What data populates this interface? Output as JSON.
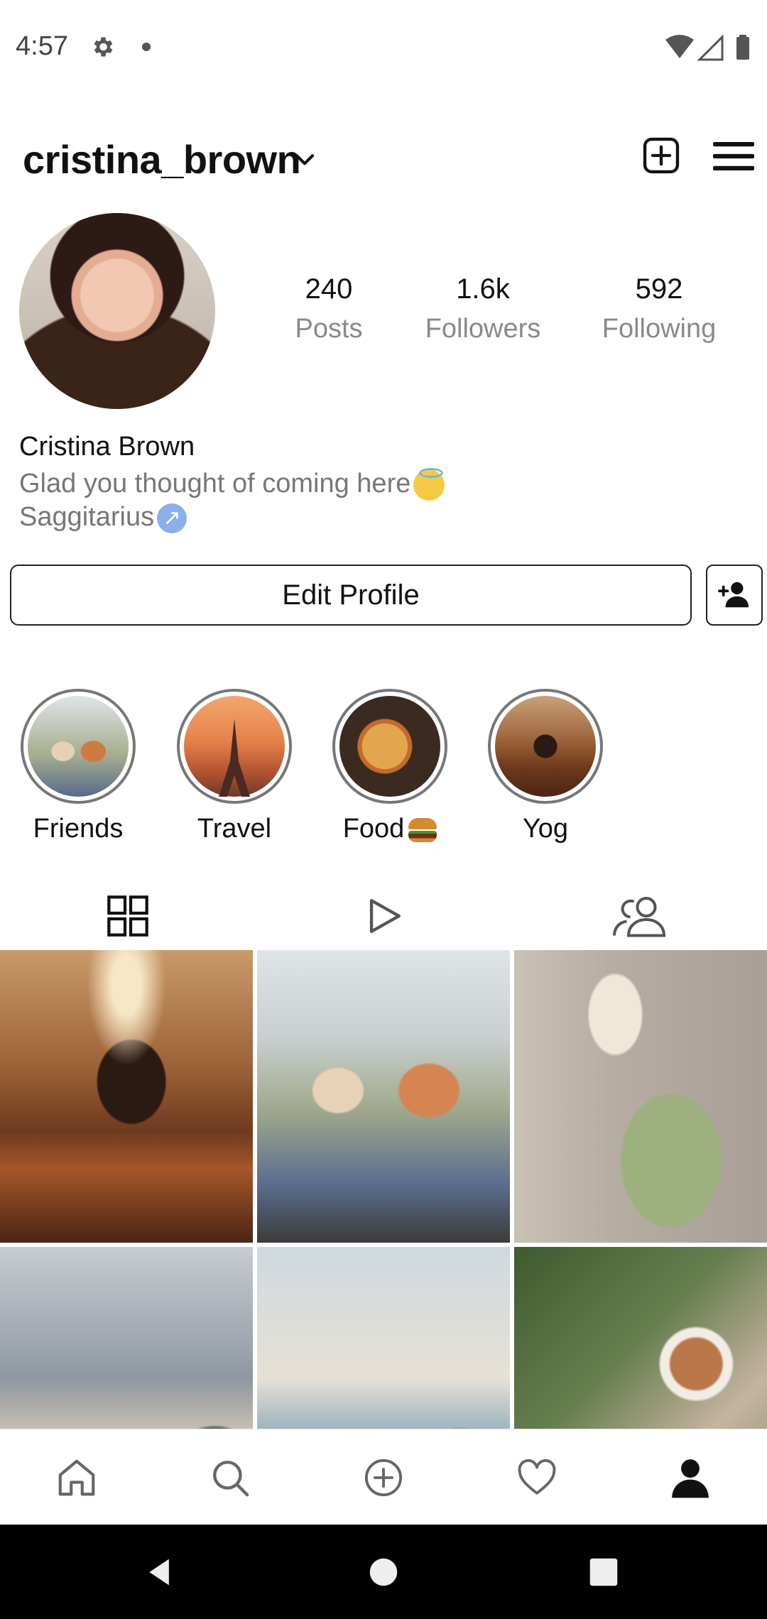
{
  "status_bar": {
    "time": "4:57",
    "icons": [
      "gear-icon",
      "notification-dot",
      "wifi-icon",
      "signal-icon",
      "battery-icon"
    ]
  },
  "header": {
    "username": "cristina_brown"
  },
  "stats": {
    "posts": {
      "value": "240",
      "label": "Posts"
    },
    "followers": {
      "value": "1.6k",
      "label": "Followers"
    },
    "following": {
      "value": "592",
      "label": "Following"
    }
  },
  "bio": {
    "full_name": "Cristina Brown",
    "line1": "Glad you thought of coming here",
    "line2": "Saggitarius"
  },
  "buttons": {
    "edit_profile": "Edit Profile"
  },
  "highlights": [
    {
      "label": "Friends"
    },
    {
      "label": "Travel"
    },
    {
      "label": "Food"
    },
    {
      "label": "Yog"
    }
  ],
  "tabs": [
    "grid-icon",
    "reels-icon",
    "tagged-icon"
  ],
  "bottom_nav": [
    "home-icon",
    "search-icon",
    "add-icon",
    "heart-icon",
    "profile-icon"
  ],
  "colors": {
    "text": "#111111",
    "muted": "#8a8a8a",
    "border": "#222222",
    "ring": "#777777"
  }
}
